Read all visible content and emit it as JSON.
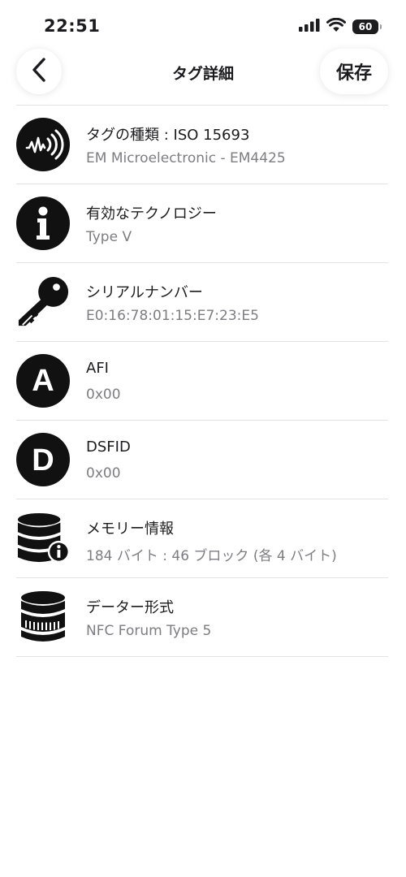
{
  "status": {
    "time": "22:51",
    "battery": "60"
  },
  "nav": {
    "title": "タグ詳細",
    "save_label": "保存"
  },
  "rows": [
    {
      "icon": "nfc-signal-icon",
      "label": "タグの種類 : ISO 15693",
      "value": "EM Microelectronic - EM4425"
    },
    {
      "icon": "info-icon",
      "label": "有効なテクノロジー",
      "value": "Type V"
    },
    {
      "icon": "key-icon",
      "label": "シリアルナンバー",
      "value": "E0:16:78:01:15:E7:23:E5"
    },
    {
      "icon": "letter-a-icon",
      "icon_text": "A",
      "label": "AFI",
      "value": "0x00"
    },
    {
      "icon": "letter-d-icon",
      "icon_text": "D",
      "label": "DSFID",
      "value": "0x00"
    },
    {
      "icon": "database-info-icon",
      "label": "メモリー情報",
      "value": "184 バイト : 46 ブロック (各 4 バイト)"
    },
    {
      "icon": "database-format-icon",
      "label": "データー形式",
      "value": "NFC Forum Type 5"
    }
  ]
}
